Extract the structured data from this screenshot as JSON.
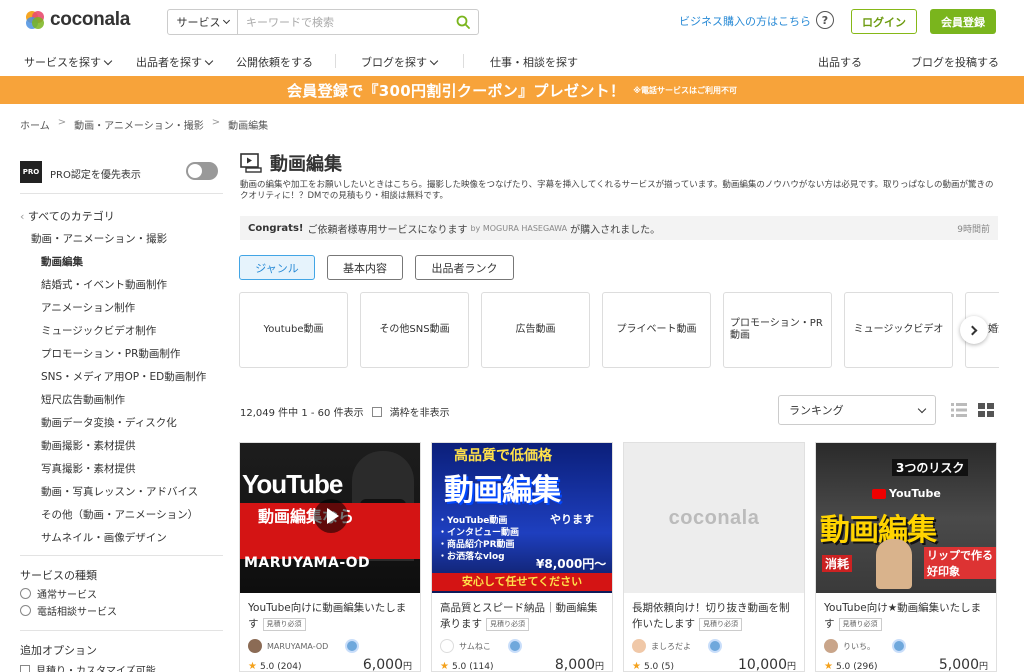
{
  "header": {
    "logo_text": "coconala",
    "search_category": "サービス",
    "search_placeholder": "キーワードで検索",
    "biz_link": "ビジネス購入の方はこちら",
    "help": "?",
    "login": "ログイン",
    "register": "会員登録"
  },
  "nav": {
    "items": [
      "サービスを探す",
      "出品者を探す",
      "公開依頼をする",
      "ブログを探す",
      "仕事・相談を探す"
    ],
    "right": [
      "出品する",
      "ブログを投稿する"
    ]
  },
  "banner": {
    "main": "会員登録で『300円割引クーポン』プレゼント！",
    "note": "※電話サービスはご利用不可",
    "color": "#f7a33a"
  },
  "breadcrumb": [
    "ホーム",
    "動画・アニメーション・撮影",
    "動画編集"
  ],
  "sidebar": {
    "pro_badge": "PRO",
    "pro_label": "PRO認定を優先表示",
    "all_categories": "すべてのカテゴリ",
    "parent": "動画・アニメーション・撮影",
    "categories": [
      "動画編集",
      "結婚式・イベント動画制作",
      "アニメーション制作",
      "ミュージックビデオ制作",
      "プロモーション・PR動画制作",
      "SNS・メディア用OP・ED動画制作",
      "短尺広告動画制作",
      "動画データ変換・ディスク化",
      "動画撮影・素材提供",
      "写真撮影・素材提供",
      "動画・写真レッスン・アドバイス",
      "その他（動画・アニメーション）",
      "サムネイル・画像デザイン"
    ],
    "service_type_title": "サービスの種類",
    "service_types": [
      "通常サービス",
      "電話相談サービス"
    ],
    "option_title": "追加オプション",
    "options": [
      "見積り・カスタマイズ可能"
    ]
  },
  "main": {
    "title": "動画編集",
    "description": "動画の編集や加工をお願いしたいときはこちら。撮影した映像をつなげたり、字幕を挿入してくれるサービスが揃っています。動画編集のノウハウがない方は必見です。取りっぱなしの動画が驚きのクオリティに！？DMでの見積もり・相談は無料です。",
    "notice": {
      "lead": "Congrats!",
      "text": "ご依頼者様専用サービスになります",
      "by": "by MOGURA HASEGAWA",
      "tail": "が購入されました。",
      "time": "9時間前"
    },
    "tabs": [
      "ジャンル",
      "基本内容",
      "出品者ランク"
    ],
    "genres": [
      "Youtube動画",
      "その他SNS動画",
      "広告動画",
      "プライベート動画",
      "プロモーション・PR動画",
      "ミュージックビデオ",
      "婚式"
    ],
    "count": "12,049 件中 1 - 60 件表示",
    "hide_full": "満枠を非表示",
    "sort": "ランキング"
  },
  "cards": [
    {
      "thumb": {
        "word": "YouTube",
        "text": "動画編集なら",
        "bottom": "MARUYAMA-OD"
      },
      "title": "YouTube向けに動画編集いたします",
      "tag": "見積り必須",
      "seller": "MARUYAMA-OD",
      "rating": "5.0",
      "reviews": "(204)",
      "price": "6,000",
      "unit": "円"
    },
    {
      "thumb": {
        "top": "高品質で低価格",
        "main": "動画編集",
        "right": "やります",
        "list": "・YouTube動画\n・インタビュー動画\n・商品紹介PR動画\n・お洒落なvlog",
        "price": "¥8,000円〜",
        "foot": "安心して任せてください"
      },
      "title": "高品質とスピード納品｜動画編集承ります",
      "tag": "見積り必須",
      "seller": "サムねこ",
      "rating": "5.0",
      "reviews": "(114)",
      "price": "8,000",
      "unit": "円"
    },
    {
      "thumb": {
        "logo": "coconala"
      },
      "title": "長期依頼向け！切り抜き動画を制作いたします",
      "tag": "見積り必須",
      "seller": "ましろだよ",
      "rating": "5.0",
      "reviews": "(5)",
      "price": "10,000",
      "unit": "円"
    },
    {
      "thumb": {
        "risk": "3つのリスク",
        "yt": "YouTube",
        "main": "動画編集",
        "l1": "消耗",
        "l2": "リップで作る 好印象"
      },
      "title": "YouTube向け★動画編集いたします",
      "tag": "見積り必須",
      "seller": "りいち。",
      "rating": "5.0",
      "reviews": "(296)",
      "price": "5,000",
      "unit": "円"
    }
  ]
}
